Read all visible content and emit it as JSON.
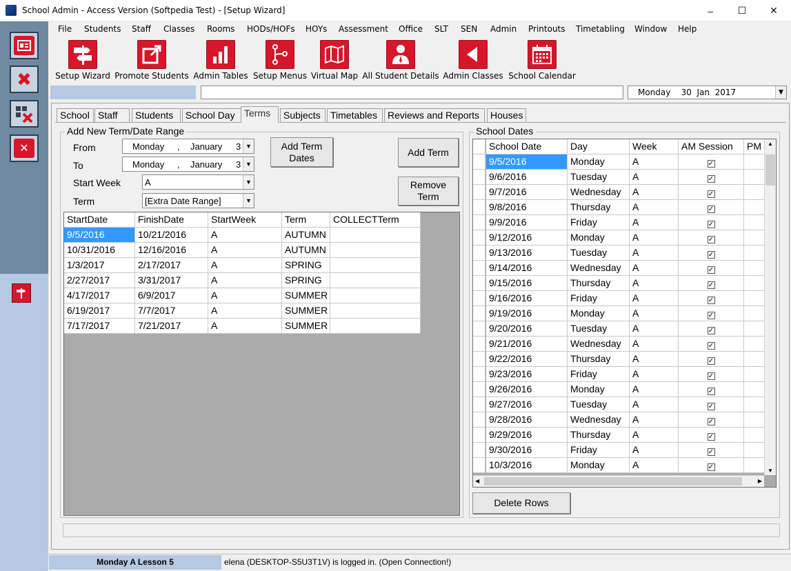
{
  "window": {
    "title": "School Admin - Access Version (Softpedia Test) - [Setup Wizard]",
    "minimize": "–",
    "maximize": "☐",
    "close": "✕"
  },
  "menu": [
    "File",
    "Students",
    "Staff",
    "Classes",
    "Rooms",
    "HODs/HOFs",
    "HOYs",
    "Assessment",
    "Office",
    "SLT",
    "SEN",
    "Admin",
    "Printouts",
    "Timetabling",
    "Window",
    "Help"
  ],
  "toolbar": [
    {
      "label": "Setup Wizard",
      "icon": "signpost-icon"
    },
    {
      "label": "Promote Students",
      "icon": "external-link-icon"
    },
    {
      "label": "Admin Tables",
      "icon": "bar-chart-icon"
    },
    {
      "label": "Setup Menus",
      "icon": "branch-icon"
    },
    {
      "label": "Virtual Map",
      "icon": "map-icon"
    },
    {
      "label": "All Student Details",
      "icon": "person-icon"
    },
    {
      "label": "Admin Classes",
      "icon": "play-back-icon"
    },
    {
      "label": "School Calendar",
      "icon": "calendar-icon"
    }
  ],
  "top_date": "Monday    30  Jan  2017",
  "tabs": [
    "School",
    "Staff",
    "Students",
    "School Day",
    "Terms",
    "Subjects",
    "Timetables",
    "Reviews and Reports",
    "Houses"
  ],
  "active_tab": "Terms",
  "add_term": {
    "group_title": "Add New Term/Date Range",
    "from_label": "From",
    "from_day": "Monday",
    "from_sep": ",",
    "from_month": "January",
    "from_num": "3",
    "to_label": "To",
    "to_day": "Monday",
    "to_sep": ",",
    "to_month": "January",
    "to_num": "3",
    "start_week_label": "Start Week",
    "start_week_value": "A",
    "term_label": "Term",
    "term_value": "[Extra Date Range]",
    "add_term_dates": "Add Term Dates",
    "add_term": "Add Term",
    "remove_term": "Remove Term"
  },
  "terms_table": {
    "columns": [
      "StartDate",
      "FinishDate",
      "StartWeek",
      "Term",
      "COLLECTTerm"
    ],
    "rows": [
      [
        "9/5/2016",
        "10/21/2016",
        "A",
        "AUTUMN",
        ""
      ],
      [
        "10/31/2016",
        "12/16/2016",
        "A",
        "AUTUMN",
        ""
      ],
      [
        "1/3/2017",
        "2/17/2017",
        "A",
        "SPRING",
        ""
      ],
      [
        "2/27/2017",
        "3/31/2017",
        "A",
        "SPRING",
        ""
      ],
      [
        "4/17/2017",
        "6/9/2017",
        "A",
        "SUMMER",
        ""
      ],
      [
        "6/19/2017",
        "7/7/2017",
        "A",
        "SUMMER",
        ""
      ],
      [
        "7/17/2017",
        "7/21/2017",
        "A",
        "SUMMER",
        ""
      ]
    ]
  },
  "school_dates": {
    "group_title": "School Dates",
    "columns": [
      "School Date",
      "Day",
      "Week",
      "AM Session",
      "PM"
    ],
    "rows": [
      [
        "9/5/2016",
        "Monday",
        "A"
      ],
      [
        "9/6/2016",
        "Tuesday",
        "A"
      ],
      [
        "9/7/2016",
        "Wednesday",
        "A"
      ],
      [
        "9/8/2016",
        "Thursday",
        "A"
      ],
      [
        "9/9/2016",
        "Friday",
        "A"
      ],
      [
        "9/12/2016",
        "Monday",
        "A"
      ],
      [
        "9/13/2016",
        "Tuesday",
        "A"
      ],
      [
        "9/14/2016",
        "Wednesday",
        "A"
      ],
      [
        "9/15/2016",
        "Thursday",
        "A"
      ],
      [
        "9/16/2016",
        "Friday",
        "A"
      ],
      [
        "9/19/2016",
        "Monday",
        "A"
      ],
      [
        "9/20/2016",
        "Tuesday",
        "A"
      ],
      [
        "9/21/2016",
        "Wednesday",
        "A"
      ],
      [
        "9/22/2016",
        "Thursday",
        "A"
      ],
      [
        "9/23/2016",
        "Friday",
        "A"
      ],
      [
        "9/26/2016",
        "Monday",
        "A"
      ],
      [
        "9/27/2016",
        "Tuesday",
        "A"
      ],
      [
        "9/28/2016",
        "Wednesday",
        "A"
      ],
      [
        "9/29/2016",
        "Thursday",
        "A"
      ],
      [
        "9/30/2016",
        "Friday",
        "A"
      ],
      [
        "10/3/2016",
        "Monday",
        "A"
      ]
    ],
    "checkmark": "✓",
    "delete_rows": "Delete Rows"
  },
  "status": {
    "lesson": "Monday A Lesson 5",
    "login": "elena (DESKTOP-S5U3T1V) is logged in. (Open Connection!)"
  },
  "colors": {
    "accent_red": "#d6162b",
    "sidebar": "#6f8aa0",
    "highlight": "#b6c9e2",
    "selection": "#3399ff"
  }
}
